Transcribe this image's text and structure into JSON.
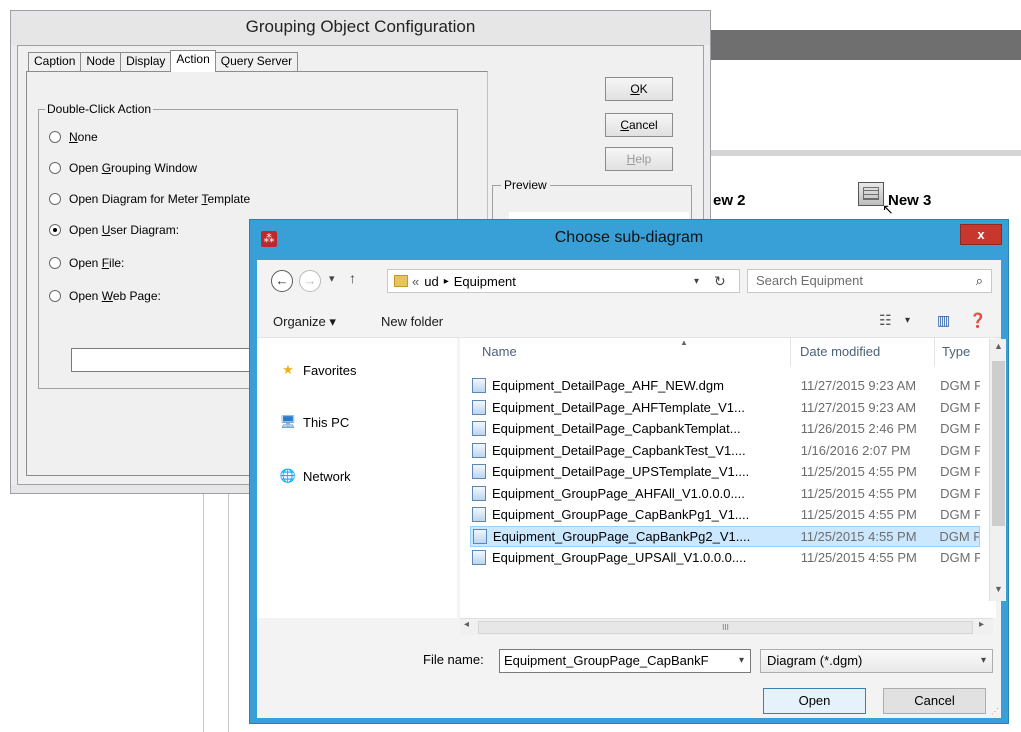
{
  "background": {
    "label_new2": "ew 2",
    "label_new3": "New 3"
  },
  "grouping_dialog": {
    "title": "Grouping Object Configuration",
    "tabs": [
      "Caption",
      "Node",
      "Display",
      "Action",
      "Query Server"
    ],
    "active_tab": "Action",
    "groupbox_label": "Double-Click Action",
    "options": [
      {
        "pre": "",
        "u": "N",
        "post": "one",
        "checked": false
      },
      {
        "pre": "Open ",
        "u": "G",
        "post": "rouping Window",
        "checked": false
      },
      {
        "pre": "Open Diagram for Meter ",
        "u": "T",
        "post": "emplate",
        "checked": false
      },
      {
        "pre": "Open ",
        "u": "U",
        "post": "ser Diagram:",
        "checked": true
      },
      {
        "pre": "Open ",
        "u": "F",
        "post": "ile:",
        "checked": false
      },
      {
        "pre": "Open ",
        "u": "W",
        "post": "eb Page:",
        "checked": false
      }
    ],
    "textbox_value": "",
    "buttons": {
      "ok": {
        "u": "O",
        "post": "K"
      },
      "cancel": {
        "u": "C",
        "post": "ancel"
      },
      "help": {
        "u": "H",
        "post": "elp"
      }
    },
    "preview_label": "Preview"
  },
  "file_dialog": {
    "title": "Choose sub-diagram",
    "close_label": "x",
    "breadcrumb": {
      "prefix": "«",
      "parent": "ud",
      "sep": "▸",
      "current": "Equipment"
    },
    "search_placeholder": "Search Equipment",
    "toolbar": {
      "organize": "Organize ▾",
      "new_folder": "New folder"
    },
    "nav_items": [
      {
        "label": "Favorites",
        "icon": "star-icon"
      },
      {
        "label": "This PC",
        "icon": "computer-icon"
      },
      {
        "label": "Network",
        "icon": "network-icon"
      }
    ],
    "columns": {
      "name": "Name",
      "date": "Date modified",
      "type": "Type"
    },
    "files": [
      {
        "name": "Equipment_DetailPage_AHF_NEW.dgm",
        "date": "11/27/2015 9:23 AM",
        "type": "DGM F"
      },
      {
        "name": "Equipment_DetailPage_AHFTemplate_V1...",
        "date": "11/27/2015 9:23 AM",
        "type": "DGM F"
      },
      {
        "name": "Equipment_DetailPage_CapbankTemplat...",
        "date": "11/26/2015 2:46 PM",
        "type": "DGM F"
      },
      {
        "name": "Equipment_DetailPage_CapbankTest_V1....",
        "date": "1/16/2016 2:07 PM",
        "type": "DGM F"
      },
      {
        "name": "Equipment_DetailPage_UPSTemplate_V1....",
        "date": "11/25/2015 4:55 PM",
        "type": "DGM F"
      },
      {
        "name": "Equipment_GroupPage_AHFAll_V1.0.0.0....",
        "date": "11/25/2015 4:55 PM",
        "type": "DGM F"
      },
      {
        "name": "Equipment_GroupPage_CapBankPg1_V1....",
        "date": "11/25/2015 4:55 PM",
        "type": "DGM F"
      },
      {
        "name": "Equipment_GroupPage_CapBankPg2_V1....",
        "date": "11/25/2015 4:55 PM",
        "type": "DGM F"
      },
      {
        "name": "Equipment_GroupPage_UPSAll_V1.0.0.0....",
        "date": "11/25/2015 4:55 PM",
        "type": "DGM F"
      }
    ],
    "selected_index": 7,
    "file_name_label": "File name:",
    "file_name_value": "Equipment_GroupPage_CapBankF",
    "file_type_value": "Diagram (*.dgm)",
    "open_label": "Open",
    "cancel_label": "Cancel",
    "scroll_mid": "III"
  }
}
